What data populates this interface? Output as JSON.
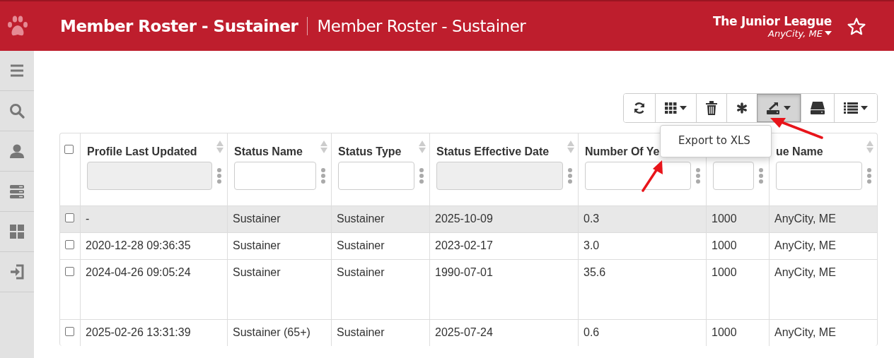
{
  "header": {
    "title": "Member Roster - Sustainer",
    "subtitle": "Member Roster - Sustainer",
    "organization": "The Junior League",
    "location": "AnyCity, ME"
  },
  "toolbar": [
    {
      "kind": "refresh",
      "pressed": false,
      "dropdown": false
    },
    {
      "kind": "columns",
      "pressed": false,
      "dropdown": true
    },
    {
      "kind": "trash",
      "pressed": false,
      "dropdown": false
    },
    {
      "kind": "asterisk",
      "pressed": false,
      "dropdown": false
    },
    {
      "kind": "export",
      "pressed": true,
      "dropdown": true
    },
    {
      "kind": "drive",
      "pressed": false,
      "dropdown": false
    },
    {
      "kind": "list",
      "pressed": false,
      "dropdown": true
    }
  ],
  "export_menu": {
    "items": [
      "Export to XLS"
    ]
  },
  "table": {
    "select_all": {
      "checked": false
    },
    "columns": [
      {
        "heading": "Profile Last Updated",
        "sortable": true,
        "filter": {
          "disabled": true
        }
      },
      {
        "heading": "Status Name",
        "sortable": true,
        "filter": {
          "disabled": false
        }
      },
      {
        "heading": "Status Type",
        "sortable": true,
        "filter": {
          "disabled": false
        }
      },
      {
        "heading": "Status Effective Date",
        "sortable": true,
        "filter": {
          "disabled": true
        }
      },
      {
        "heading": "Number Of Ye",
        "filter": {
          "disabled": false
        }
      },
      {
        "filter": {
          "disabled": false
        }
      },
      {
        "heading": "ue Name",
        "sortable": true,
        "filter": {
          "disabled": false
        }
      }
    ],
    "rows": [
      {
        "checked": false,
        "highlighted": true,
        "tall": false,
        "cells": [
          "-",
          "Sustainer",
          "Sustainer",
          "2025-10-09",
          "0.3",
          "1000",
          "AnyCity, ME"
        ]
      },
      {
        "checked": false,
        "highlighted": false,
        "tall": false,
        "cells": [
          "2020-12-28 09:36:35",
          "Sustainer",
          "Sustainer",
          "2023-02-17",
          "3.0",
          "1000",
          "AnyCity, ME"
        ]
      },
      {
        "checked": false,
        "highlighted": false,
        "tall": true,
        "cells": [
          "2024-04-26 09:05:24",
          "Sustainer",
          "Sustainer",
          "1990-07-01",
          "35.6",
          "1000",
          "AnyCity, ME"
        ]
      },
      {
        "checked": false,
        "highlighted": false,
        "tall": false,
        "cells": [
          "2025-02-26 13:31:39",
          "Sustainer (65+)",
          "Sustainer",
          "2025-07-24",
          "0.6",
          "1000",
          "AnyCity, ME"
        ]
      }
    ]
  }
}
